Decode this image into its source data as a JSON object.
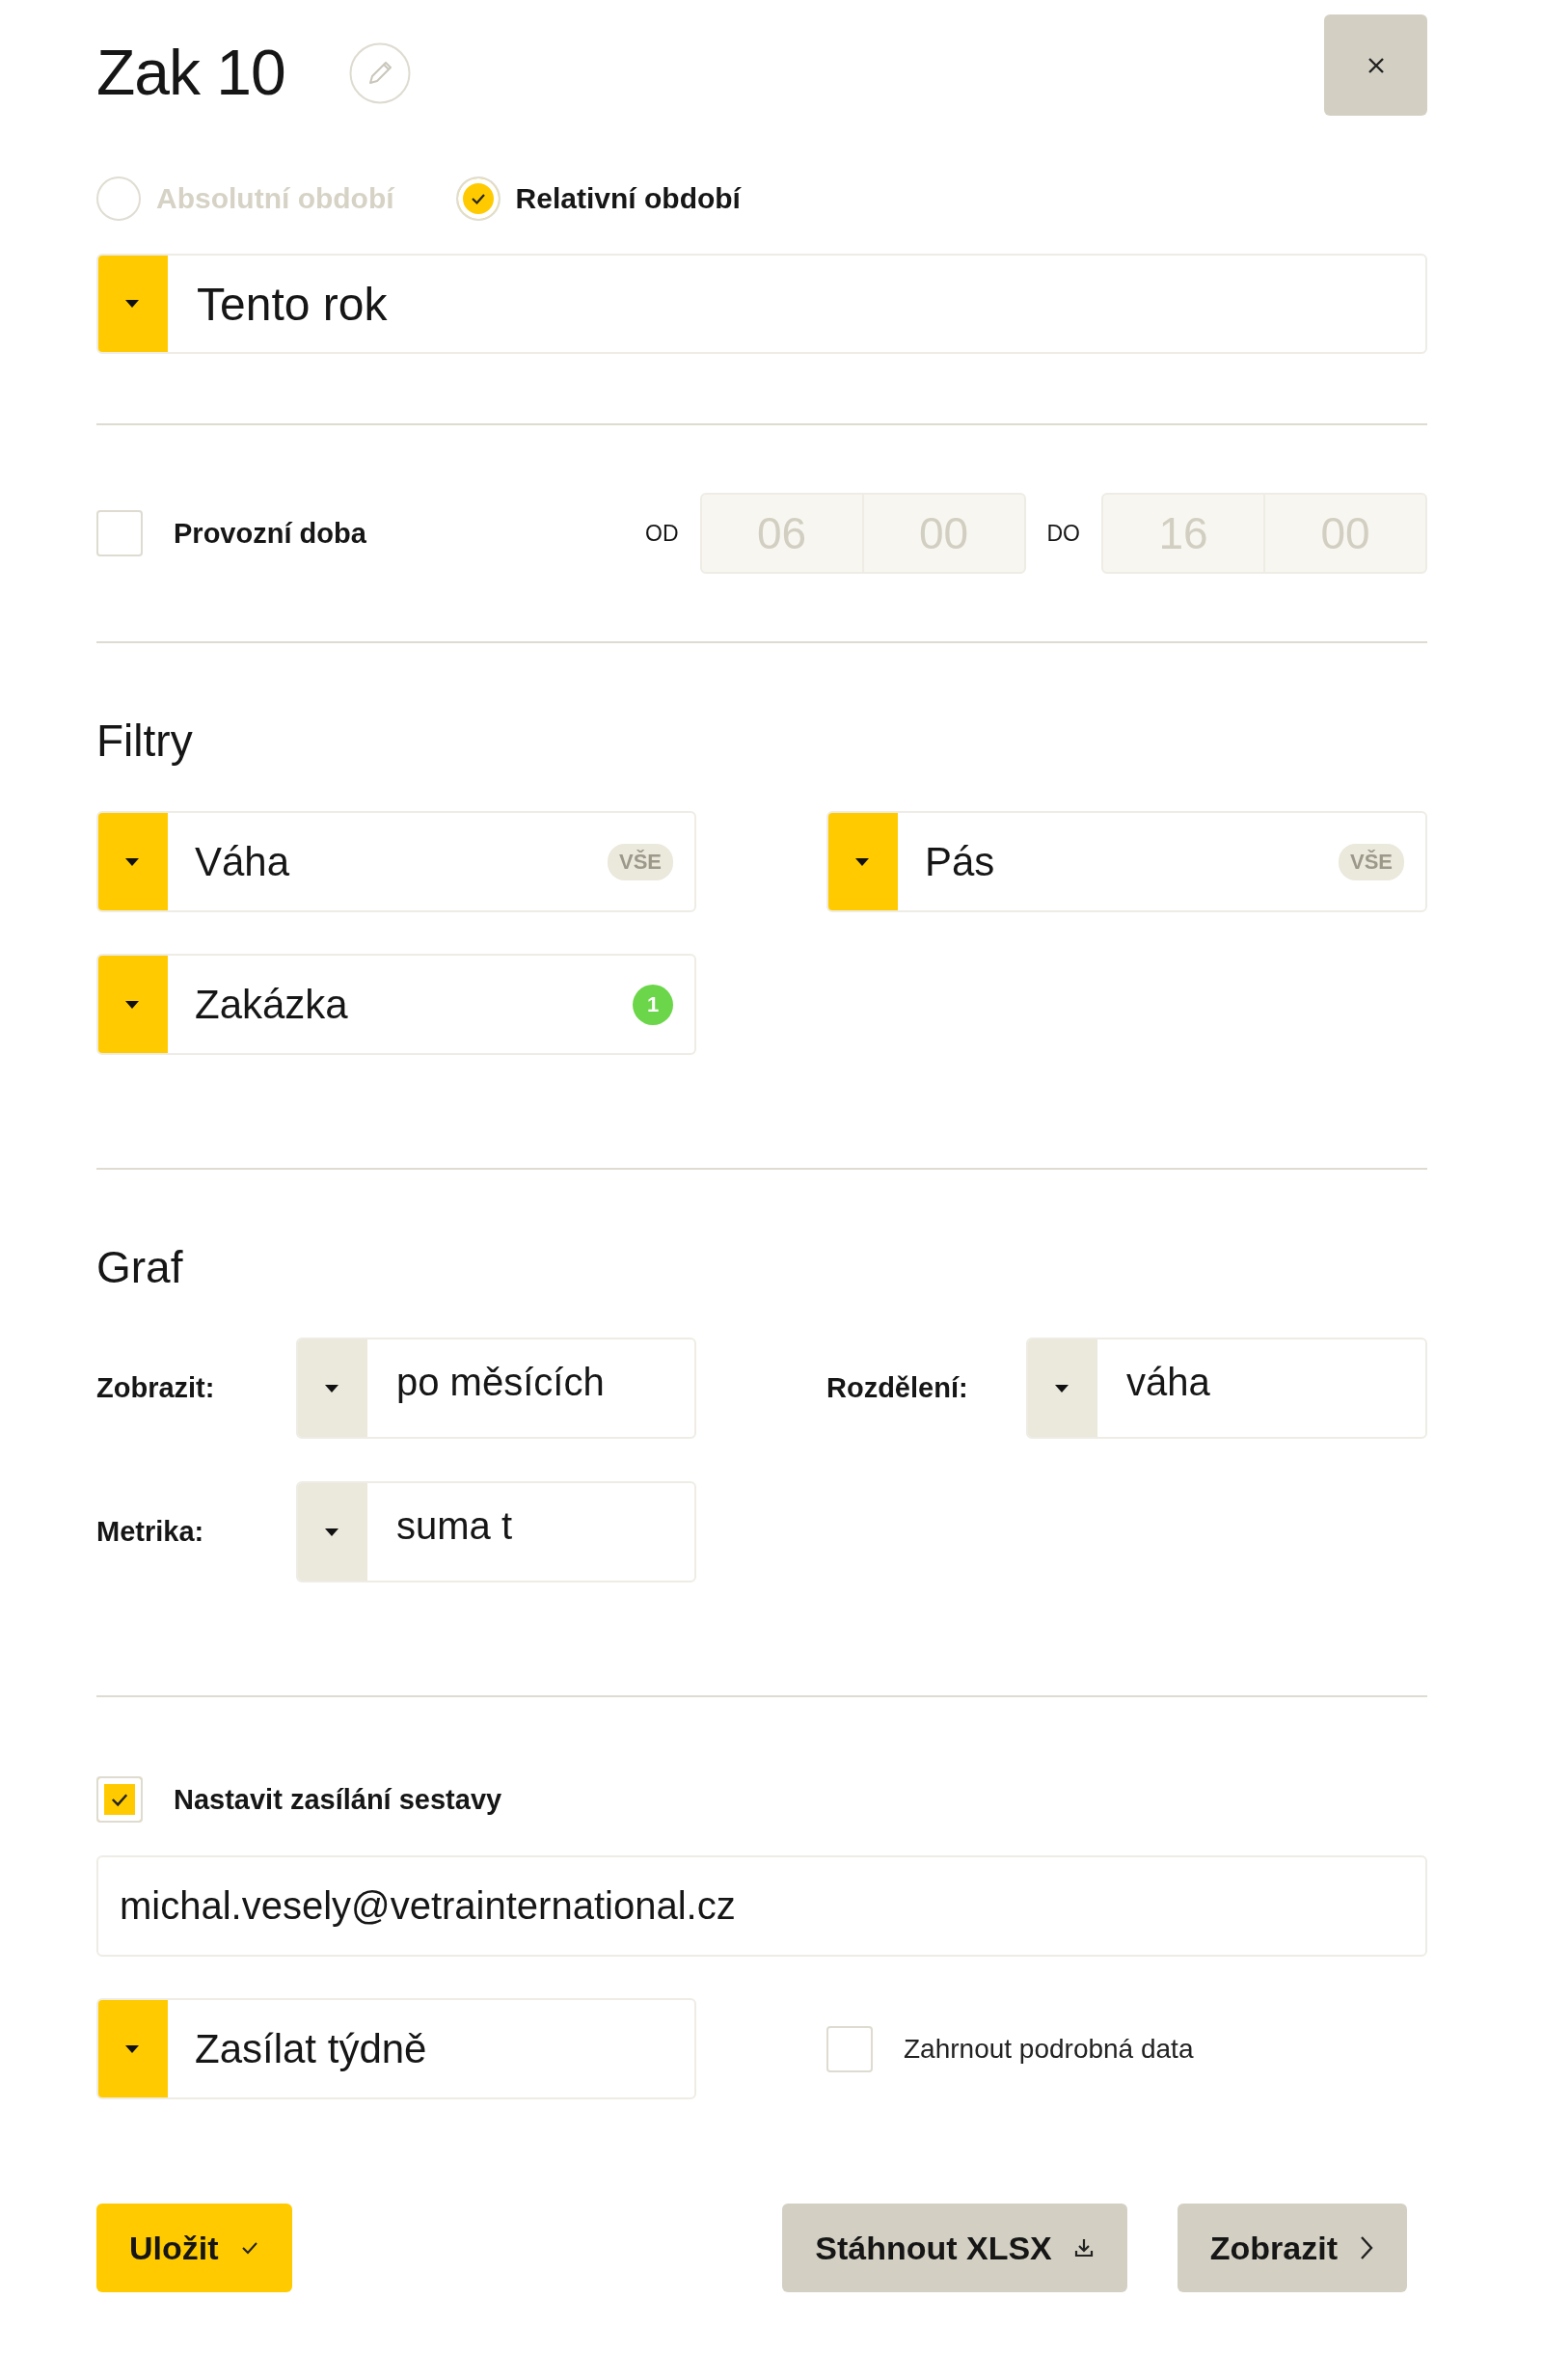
{
  "title": "Zak 10",
  "period_modes": [
    {
      "label": "Absolutní období",
      "selected": false
    },
    {
      "label": "Relativní období",
      "selected": true
    }
  ],
  "period_select": {
    "value": "Tento rok"
  },
  "operating_hours": {
    "label": "Provozní doba",
    "checked": false,
    "from_label": "OD",
    "from": [
      "06",
      "00"
    ],
    "to_label": "DO",
    "to": [
      "16",
      "00"
    ]
  },
  "filters": {
    "title": "Filtry",
    "items": [
      {
        "label": "Váha",
        "badge": "VŠE",
        "kind": "all"
      },
      {
        "label": "Pás",
        "badge": "VŠE",
        "kind": "all"
      },
      {
        "label": "Zakázka",
        "badge": "1",
        "kind": "count"
      }
    ]
  },
  "chart_settings": {
    "title": "Graf",
    "fields": [
      {
        "label": "Zobrazit:",
        "value": "po měsících"
      },
      {
        "label": "Rozdělení:",
        "value": "váha"
      },
      {
        "label": "Metrika:",
        "value": "suma t"
      }
    ]
  },
  "sending": {
    "label": "Nastavit zasílání sestavy",
    "checked": true,
    "email": "michal.vesely@vetrainternational.cz",
    "frequency": "Zasílat týdně",
    "detail_label": "Zahrnout podrobná data",
    "detail_checked": false
  },
  "buttons": [
    {
      "label": "Uložit",
      "kind": "save"
    },
    {
      "label": "Stáhnout XLSX",
      "kind": "download"
    },
    {
      "label": "Zobrazit",
      "kind": "show"
    }
  ]
}
